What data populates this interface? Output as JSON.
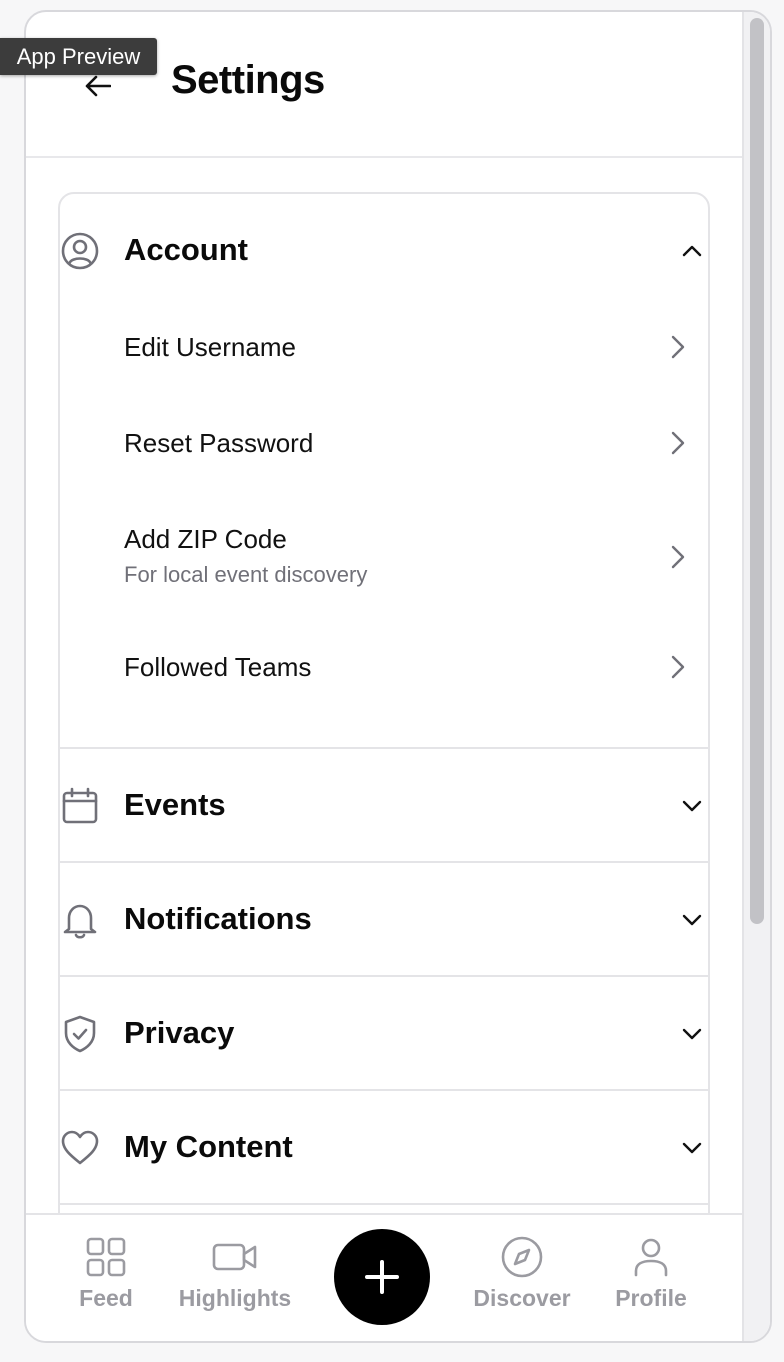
{
  "overlay": {
    "preview_label": "App Preview"
  },
  "header": {
    "title": "Settings",
    "back_icon": "arrow-left-icon"
  },
  "sections": [
    {
      "label": "Account",
      "icon": "user-circle-icon",
      "state": "expanded",
      "items": [
        {
          "label": "Edit Username",
          "hint": ""
        },
        {
          "label": "Reset Password",
          "hint": ""
        },
        {
          "label": "Add ZIP Code",
          "hint": "For local event discovery"
        },
        {
          "label": "Followed Teams",
          "hint": ""
        }
      ]
    },
    {
      "label": "Events",
      "icon": "calendar-icon",
      "state": "collapsed"
    },
    {
      "label": "Notifications",
      "icon": "bell-icon",
      "state": "collapsed"
    },
    {
      "label": "Privacy",
      "icon": "shield-check-icon",
      "state": "collapsed"
    },
    {
      "label": "My Content",
      "icon": "heart-icon",
      "state": "collapsed"
    }
  ],
  "tabbar": {
    "tabs": [
      {
        "label": "Feed",
        "icon": "grid-icon"
      },
      {
        "label": "Highlights",
        "icon": "video-camera-icon"
      },
      {
        "label": "Discover",
        "icon": "compass-icon"
      },
      {
        "label": "Profile",
        "icon": "person-icon"
      }
    ],
    "fab_icon": "plus-icon"
  },
  "colors": {
    "background": "#ffffff",
    "text_primary": "#111111",
    "text_secondary": "#707078",
    "tab_inactive": "#9b9ba1",
    "fab": "#000000",
    "border": "#e4e4e7"
  }
}
